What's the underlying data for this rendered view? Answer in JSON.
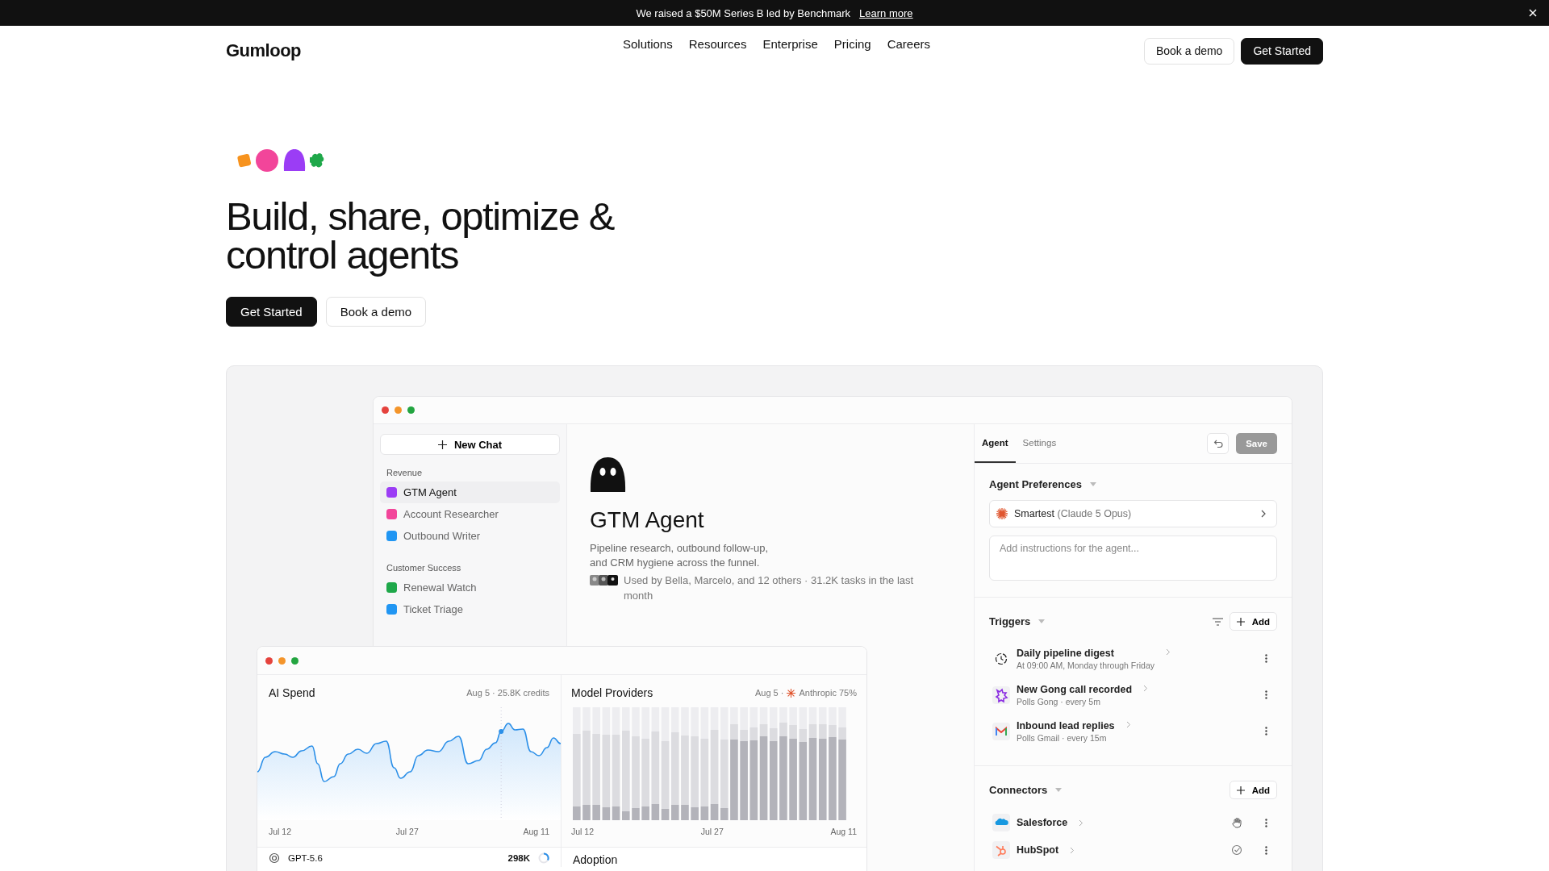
{
  "announcement": {
    "text": "We raised a $50M Series B led by Benchmark",
    "link": "Learn more"
  },
  "nav": {
    "logo": "Gumloop",
    "links": [
      "Solutions",
      "Resources",
      "Enterprise",
      "Pricing",
      "Careers"
    ],
    "buttons": [
      {
        "label": "Book a demo",
        "kind": "secondary"
      },
      {
        "label": "Get Started",
        "kind": "primary"
      }
    ]
  },
  "hero": {
    "mascots": [
      {
        "kind": "square",
        "color": "#f7931e"
      },
      {
        "kind": "circle",
        "color": "#f2459a"
      },
      {
        "kind": "ghost",
        "color": "#9b3df5"
      },
      {
        "kind": "clover",
        "color": "#1fa84a"
      }
    ],
    "headline": [
      "Build, share, optimize &",
      "control agents"
    ],
    "buttons": [
      {
        "label": "Get Started",
        "kind": "primary"
      },
      {
        "label": "Book a demo",
        "kind": "secondary"
      }
    ]
  },
  "app_window": {
    "new_chat": "New Chat",
    "groups": [
      {
        "label": "Revenue",
        "items": [
          {
            "label": "GTM Agent",
            "color": "#9b3df5",
            "selected": true
          },
          {
            "label": "Account Researcher",
            "color": "#f2459a",
            "selected": false
          },
          {
            "label": "Outbound Writer",
            "color": "#2196f3",
            "selected": false
          }
        ]
      },
      {
        "label": "Customer Success",
        "items": [
          {
            "label": "Renewal Watch",
            "color": "#1fa84a",
            "selected": false
          },
          {
            "label": "Ticket Triage",
            "color": "#2196f3",
            "selected": false
          }
        ]
      }
    ],
    "agent": {
      "title": "GTM Agent",
      "description": "Pipeline research, outbound follow-up, and CRM hygiene across the funnel.",
      "usage": "Used by Bella, Marcelo, and 12 others · 31.2K tasks in the last month"
    },
    "panel": {
      "tabs": [
        {
          "label": "Agent",
          "selected": true
        },
        {
          "label": "Settings",
          "selected": false
        }
      ],
      "save": "Save",
      "preferences": {
        "title": "Agent Preferences",
        "model": "Smartest",
        "model_detail": "(Claude 5 Opus)",
        "placeholder": "Add instructions for the agent..."
      },
      "triggers": {
        "title": "Triggers",
        "add": "Add",
        "items": [
          {
            "kind": "schedule",
            "title": "Daily pipeline digest",
            "subtitle": "At 09:00 AM, Monday through Friday"
          },
          {
            "kind": "gong",
            "title": "New Gong call recorded",
            "subtitle": "Polls Gong · every 5m"
          },
          {
            "kind": "gmail",
            "title": "Inbound lead replies",
            "subtitle": "Polls Gmail · every 15m"
          }
        ]
      },
      "connectors": {
        "title": "Connectors",
        "add": "Add",
        "items": [
          {
            "kind": "salesforce",
            "name": "Salesforce"
          },
          {
            "kind": "hubspot",
            "name": "HubSpot"
          }
        ]
      }
    }
  },
  "dashboard": {
    "ai_spend": {
      "title": "AI Spend",
      "meta": "Aug 5 · 25.8K credits",
      "x_labels": [
        "Jul 12",
        "Jul 27",
        "Aug 11"
      ]
    },
    "model_providers": {
      "title": "Model Providers",
      "meta_date": "Aug 5 ·",
      "meta_provider": "Anthropic 75%",
      "x_labels": [
        "Jul 12",
        "Jul 27",
        "Aug 11"
      ]
    },
    "models": [
      {
        "name": "GPT-5.6",
        "value": "298K"
      }
    ],
    "adoption": {
      "title": "Adoption"
    }
  }
}
